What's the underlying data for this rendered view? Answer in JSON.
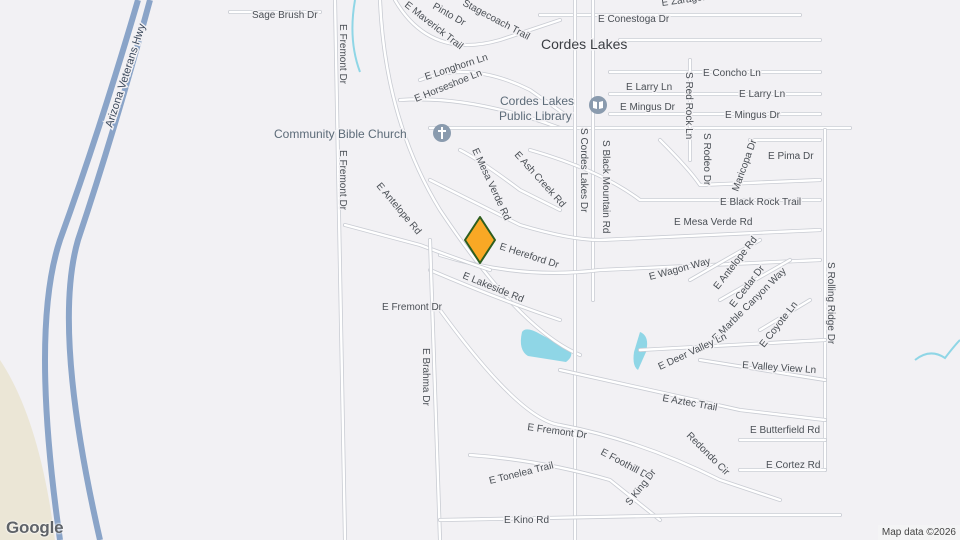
{
  "map": {
    "place_name": "Cordes Lakes",
    "pois": [
      {
        "label_lines": [
          "Cordes Lakes",
          "Public Library"
        ],
        "icon": "book-icon"
      },
      {
        "label_lines": [
          "Community Bible Church"
        ],
        "icon": "church-cross-icon"
      }
    ],
    "highway_label": "Arizona Veterans Hwy",
    "streets": [
      "Sage Brush Dr",
      "E Conestoga Dr",
      "E Zaragoza Dr",
      "Stagecoach Trail",
      "Pinto Dr",
      "E Maverick Trail",
      "E Longhorn Ln",
      "E Horseshoe Ln",
      "E Concho Ln",
      "E Larry Ln",
      "E Larry Ln",
      "E Mingus Dr",
      "E Mingus Dr",
      "S Red Rock Ln",
      "S Cordes Lakes Dr",
      "S Black Mountain Rd",
      "S Rodeo Dr",
      "Maricopa Dr",
      "E Pima Dr",
      "E Black Rock Trail",
      "E Ash Creek Rd",
      "E Mesa Verde Rd",
      "E Mesa Verde Rd",
      "E Hereford Dr",
      "E Wagon Way",
      "E Antelope Rd",
      "E Antelope Rd",
      "E Cedar Dr",
      "E Marble Canyon Way",
      "S Rolling Ridge Dr",
      "E Lakeside Rd",
      "E Fremont Dr",
      "E Fremont Dr",
      "E Fremont Dr",
      "E Fremont Dr",
      "E Coyote Ln",
      "E Deer Valley Ln",
      "E Valley View Ln",
      "E Brahma Dr",
      "E Aztec Trail",
      "E Butterfield Rd",
      "Redondo Cir",
      "E Cortez Rd",
      "E Tonelea Trail",
      "E Foothill Dr",
      "S King Dr",
      "E Kino Rd"
    ],
    "marker": {
      "color": "#f9a825",
      "outline": "#2e5e1e",
      "icon": "location-marker-icon"
    },
    "colors": {
      "background": "#f2f1f4",
      "road": "#ffffff",
      "road_casing": "#c9ccd3",
      "highway": "#8aa4c8",
      "water": "#8fd6e6",
      "desert": "#ebe6d6"
    }
  },
  "google_logo": "Google",
  "attribution": "Map data ©2026"
}
